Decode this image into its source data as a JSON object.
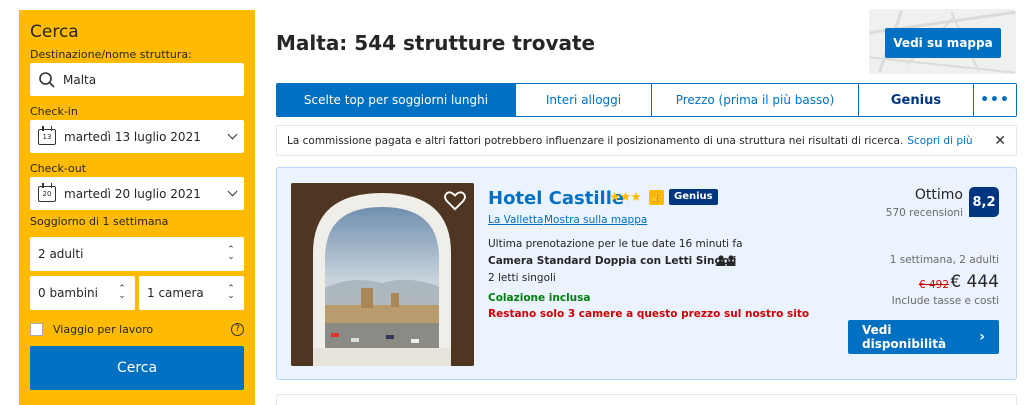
{
  "sidebar": {
    "title": "Cerca",
    "destination_label": "Destinazione/nome struttura:",
    "destination_value": "Malta",
    "checkin_label": "Check-in",
    "checkin_day": "13",
    "checkin_value": "martedì 13 luglio 2021",
    "checkout_label": "Check-out",
    "checkout_day": "20",
    "checkout_value": "martedì 20 luglio 2021",
    "stay_length": "Soggiorno di 1 settimana",
    "adults": "2 adulti",
    "children": "0 bambini",
    "rooms": "1 camera",
    "work_trip": "Viaggio per lavoro",
    "search_button": "Cerca"
  },
  "header": {
    "title": "Malta: 544 strutture trovate",
    "map_button": "Vedi su mappa"
  },
  "tabs": [
    {
      "label": "Scelte top per soggiorni lunghi",
      "active": true
    },
    {
      "label": "Interi alloggi"
    },
    {
      "label": "Prezzo (prima il più basso)"
    },
    {
      "label": "Genius"
    },
    {
      "label": "•••"
    }
  ],
  "notice": {
    "text": "La commissione pagata e altri fattori potrebbero influenzare il posizionamento di una struttura nei risultati di ricerca.",
    "link": "Scopri di più",
    "close": "✕"
  },
  "property": {
    "name": "Hotel Castille",
    "stars": "★★★",
    "genius_badge": "Genius",
    "city": "La Valletta",
    "map_link": "Mostra sulla mappa",
    "last_booked": "Ultima prenotazione per le tue date 16 minuti fa",
    "room_type": "Camera Standard Doppia con Letti Singoli",
    "beds": "2 letti singoli",
    "breakfast": "Colazione inclusa",
    "scarcity": "Restano solo 3 camere a questo prezzo sul nostro sito",
    "score_word": "Ottimo",
    "reviews": "570 recensioni",
    "score": "8,2",
    "stay_info": "1 settimana, 2 adulti",
    "old_price": "€ 492",
    "new_price": "€ 444",
    "taxes": "Include tasse e costi",
    "availability_button": "Vedi disponibilità",
    "availability_arrow": "›"
  },
  "colors": {
    "brand_yellow": "#febb02",
    "brand_blue": "#0071c2",
    "dark_blue": "#003580",
    "green": "#008009",
    "red": "#cc0000"
  }
}
